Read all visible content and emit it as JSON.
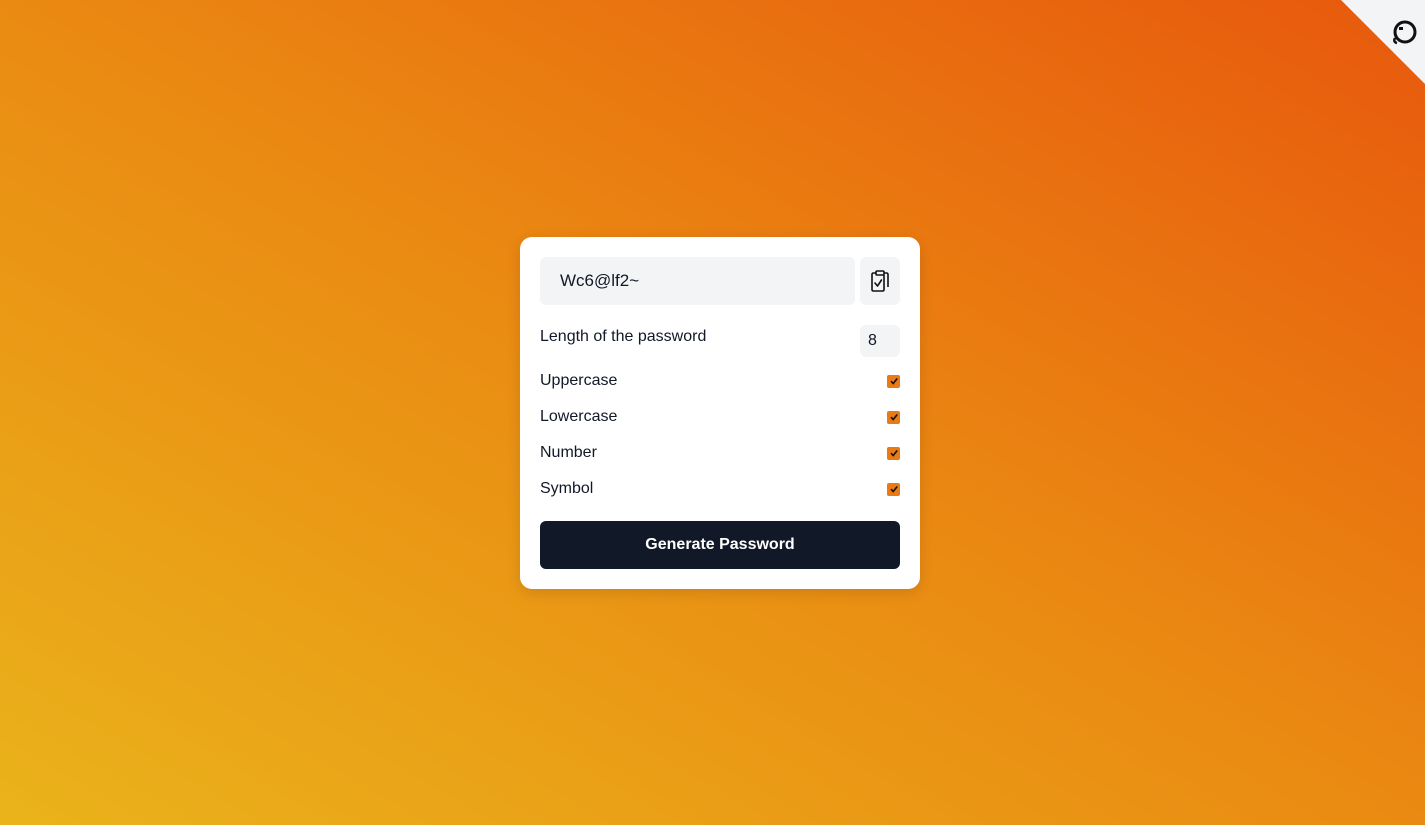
{
  "password": {
    "value": "Wc6@lf2~",
    "copy_icon": "clipboard-check-icon"
  },
  "length": {
    "label": "Length of the password",
    "value": "8"
  },
  "options": [
    {
      "label": "Uppercase",
      "checked": true
    },
    {
      "label": "Lowercase",
      "checked": true
    },
    {
      "label": "Number",
      "checked": true
    },
    {
      "label": "Symbol",
      "checked": true
    }
  ],
  "actions": {
    "generate_label": "Generate Password"
  },
  "corner": {
    "icon": "github-icon"
  },
  "colors": {
    "gradient_start": "#eab31b",
    "gradient_end": "#e8580d",
    "checkbox_accent": "#ea7a14",
    "button_bg": "#111827"
  }
}
